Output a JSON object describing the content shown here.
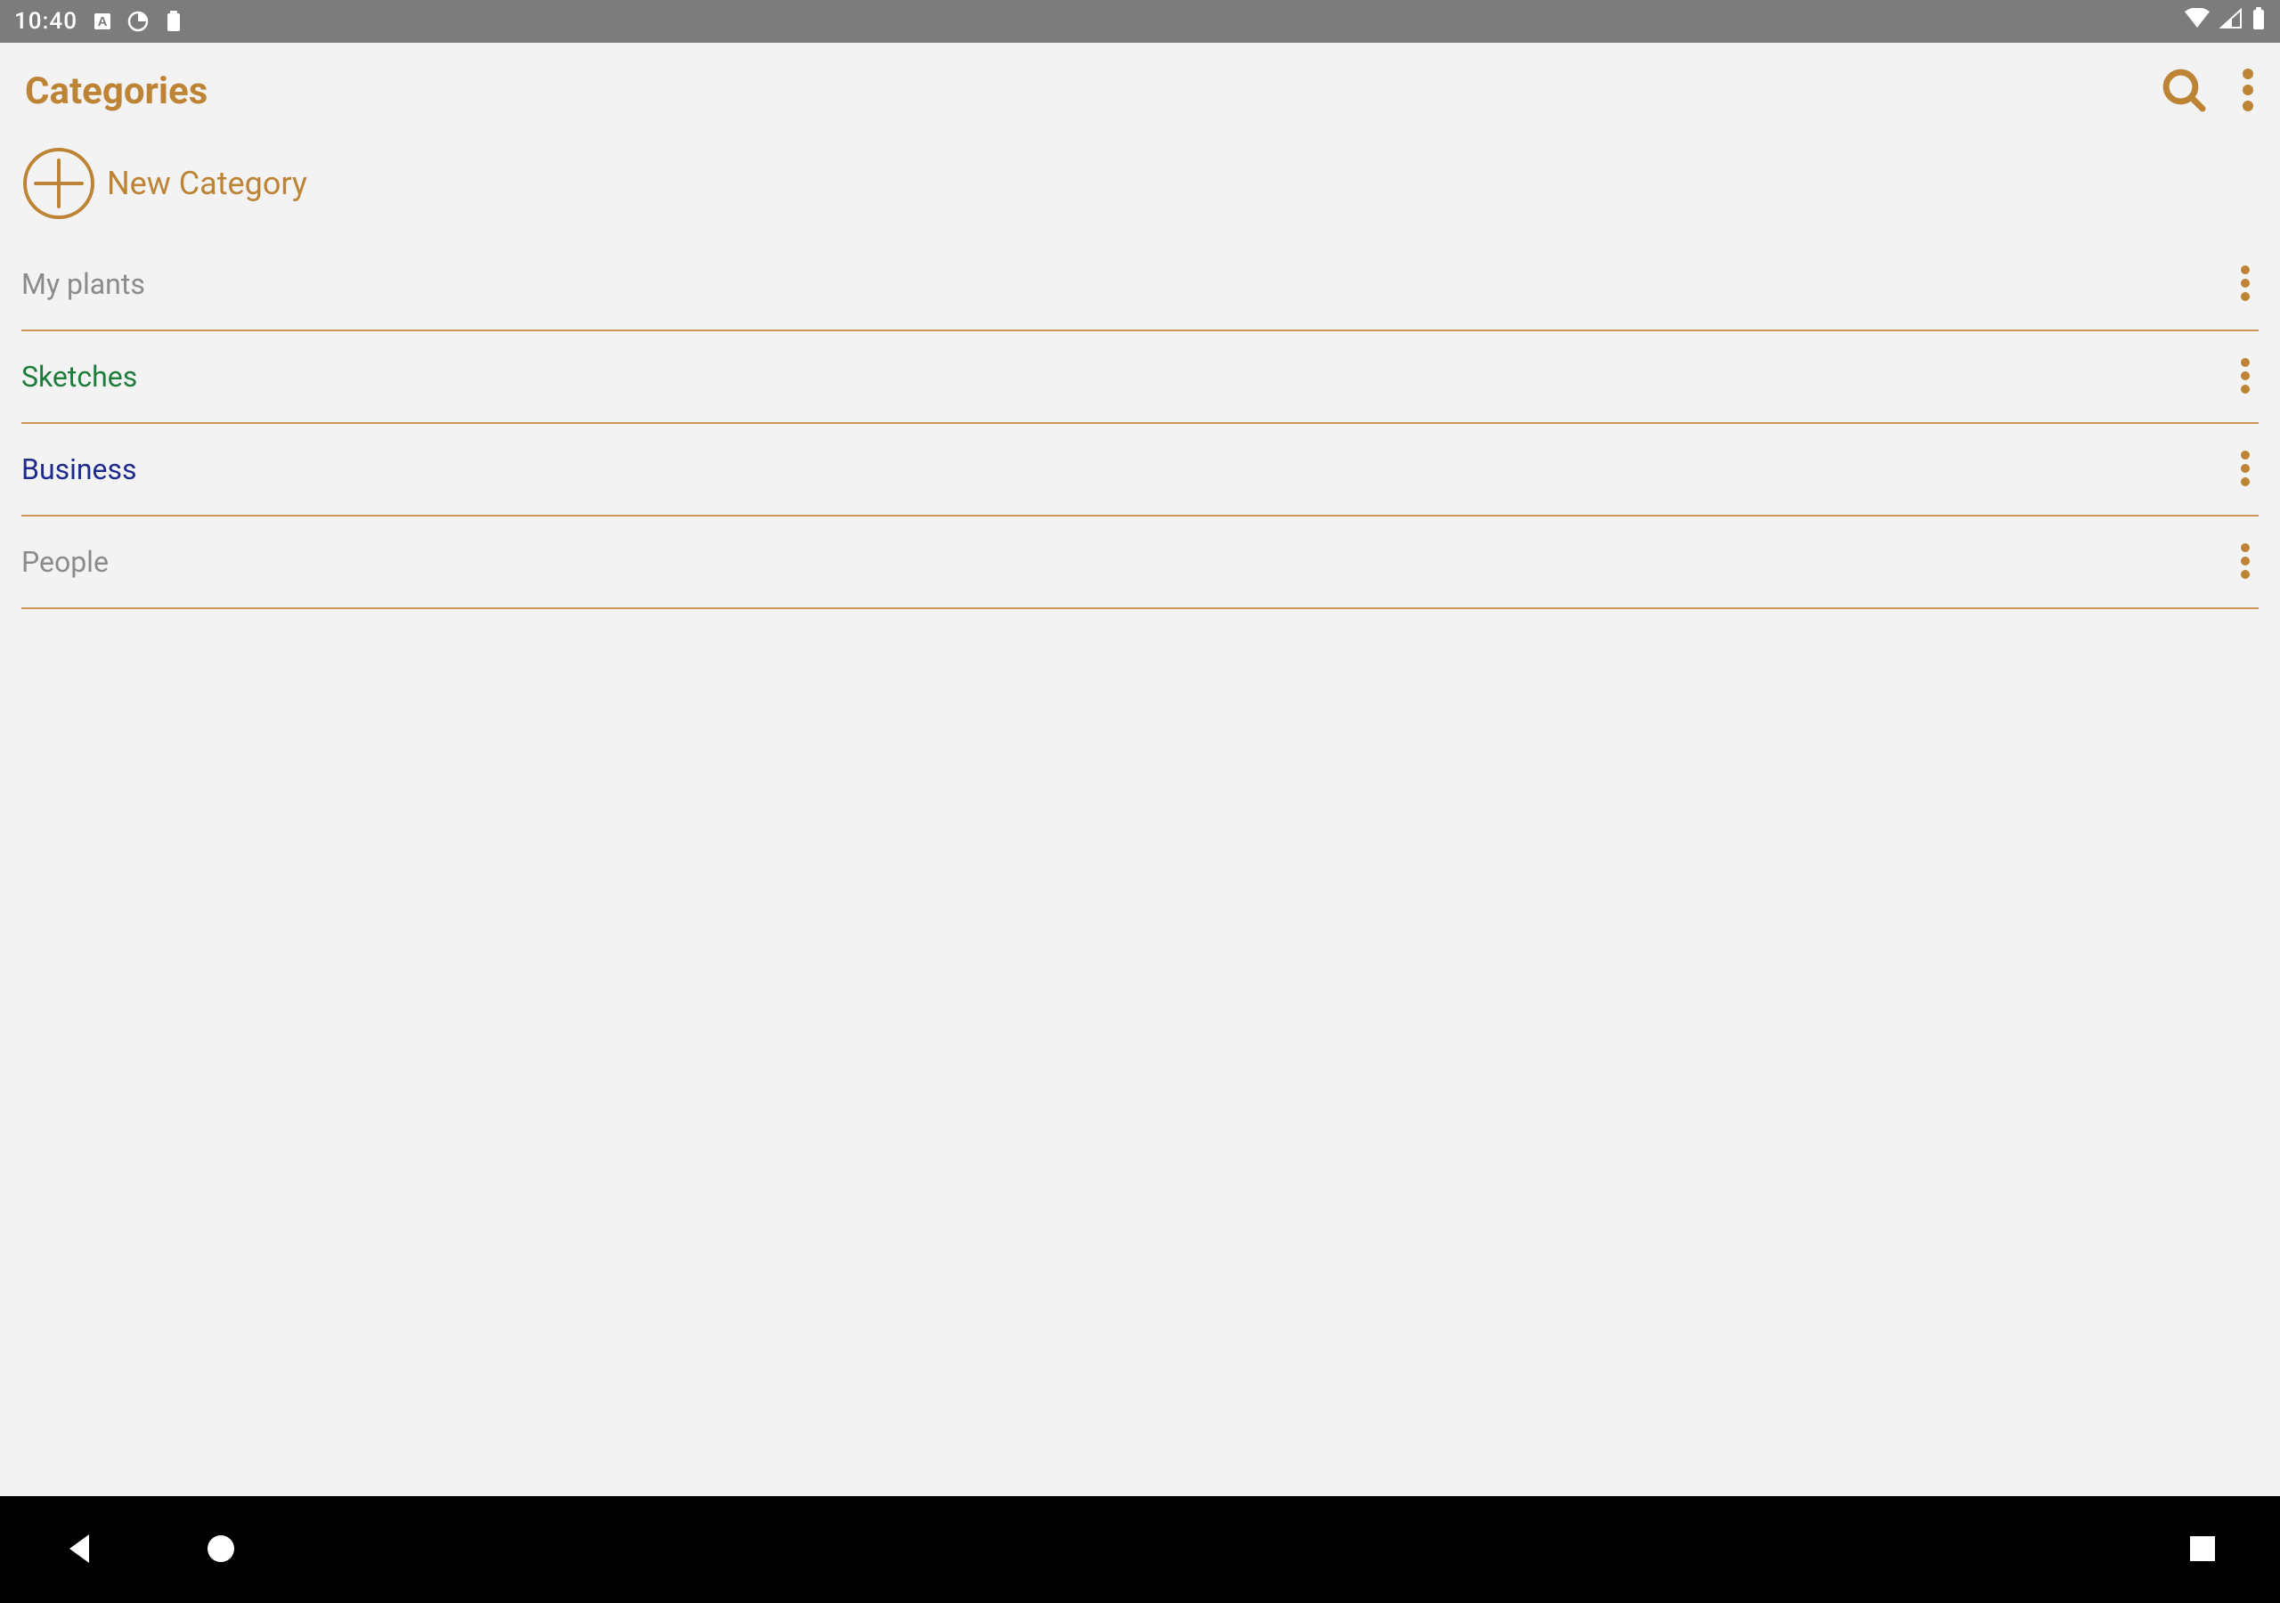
{
  "status": {
    "time": "10:40"
  },
  "header": {
    "title": "Categories"
  },
  "new_category": {
    "label": "New Category"
  },
  "categories": [
    {
      "name": "My plants",
      "color": "#8b8b8b"
    },
    {
      "name": "Sketches",
      "color": "#1e7d3b"
    },
    {
      "name": "Business",
      "color": "#1e2a8c"
    },
    {
      "name": "People",
      "color": "#8b8b8b"
    }
  ],
  "colors": {
    "accent": "#bd8436",
    "divider": "#c79555"
  }
}
